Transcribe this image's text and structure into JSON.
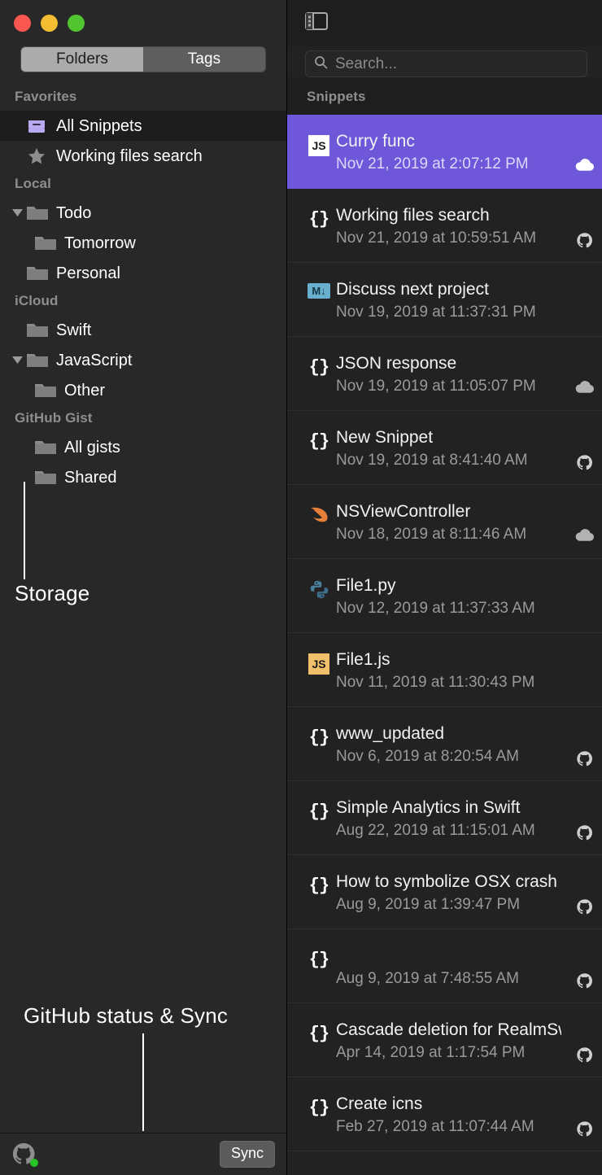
{
  "window": {
    "traffic_lights": [
      "close",
      "minimize",
      "zoom"
    ],
    "colors": {
      "close": "#f9574f",
      "minimize": "#f5bd31",
      "zoom": "#50c530",
      "selection_purple": "#6e57d8",
      "accent_icon_purple": "#b8a9f0",
      "status_green": "#23c423"
    }
  },
  "sidebar": {
    "segmented": {
      "folders_label": "Folders",
      "tags_label": "Tags",
      "selected": "Folders"
    },
    "groups": [
      {
        "label": "Favorites",
        "items": [
          {
            "label": "All Snippets",
            "icon": "inbox-tray-icon",
            "selected": true,
            "indent": 0,
            "disclosure": "none"
          },
          {
            "label": "Working files search",
            "icon": "star-icon",
            "selected": false,
            "indent": 0,
            "disclosure": "none"
          }
        ]
      },
      {
        "label": "Local",
        "items": [
          {
            "label": "Todo",
            "icon": "folder-icon",
            "selected": false,
            "indent": 0,
            "disclosure": "expanded"
          },
          {
            "label": "Tomorrow",
            "icon": "folder-icon",
            "selected": false,
            "indent": 1,
            "disclosure": "none"
          },
          {
            "label": "Personal",
            "icon": "folder-icon",
            "selected": false,
            "indent": 0,
            "disclosure": "none"
          }
        ]
      },
      {
        "label": "iCloud",
        "items": [
          {
            "label": "Swift",
            "icon": "folder-icon",
            "selected": false,
            "indent": 0,
            "disclosure": "none"
          },
          {
            "label": "JavaScript",
            "icon": "folder-icon",
            "selected": false,
            "indent": 0,
            "disclosure": "expanded"
          },
          {
            "label": "Other",
            "icon": "folder-icon",
            "selected": false,
            "indent": 1,
            "disclosure": "none"
          }
        ]
      },
      {
        "label": "GitHub Gist",
        "items": [
          {
            "label": "All gists",
            "icon": "folder-icon",
            "selected": false,
            "indent": 1,
            "disclosure": "none"
          },
          {
            "label": "Shared",
            "icon": "folder-icon",
            "selected": false,
            "indent": 1,
            "disclosure": "none"
          }
        ]
      }
    ],
    "annotations": {
      "storage": "Storage",
      "github_status_sync": "GitHub status & Sync"
    },
    "footer": {
      "github_status_icon": "github-octocat-icon",
      "github_status_indicator": "online",
      "sync_label": "Sync"
    }
  },
  "list_panel": {
    "toolbar": {
      "sidebar_toggle_icon": "sidebar-toggle-icon"
    },
    "search": {
      "icon": "search-icon",
      "placeholder": "Search...",
      "value": ""
    },
    "section_title": "Snippets",
    "snippets": [
      {
        "title": "Curry func",
        "date": "Nov 21, 2019 at 2:07:12 PM",
        "type_icon": "js-white-icon",
        "sync_badge": "icloud-cloud-icon",
        "selected": true
      },
      {
        "title": "Working files search",
        "date": "Nov 21, 2019 at 10:59:51 AM",
        "type_icon": "braces-icon",
        "sync_badge": "github-octocat-icon",
        "selected": false
      },
      {
        "title": "Discuss next project",
        "date": "Nov 19, 2019 at 11:37:31 PM",
        "type_icon": "markdown-icon",
        "sync_badge": "none",
        "selected": false
      },
      {
        "title": "JSON response",
        "date": "Nov 19, 2019 at 11:05:07 PM",
        "type_icon": "braces-icon",
        "sync_badge": "icloud-cloud-icon",
        "selected": false
      },
      {
        "title": "New Snippet",
        "date": "Nov 19, 2019 at 8:41:40 AM",
        "type_icon": "braces-icon",
        "sync_badge": "github-octocat-icon",
        "selected": false
      },
      {
        "title": "NSViewController",
        "date": "Nov 18, 2019 at 8:11:46 AM",
        "type_icon": "swift-bird-icon",
        "sync_badge": "icloud-cloud-icon",
        "selected": false
      },
      {
        "title": "File1.py",
        "date": "Nov 12, 2019 at 11:37:33 AM",
        "type_icon": "python-icon",
        "sync_badge": "none",
        "selected": false
      },
      {
        "title": "File1.js",
        "date": "Nov 11, 2019 at 11:30:43 PM",
        "type_icon": "js-amber-icon",
        "sync_badge": "none",
        "selected": false
      },
      {
        "title": "www_updated",
        "date": "Nov 6, 2019 at 8:20:54 AM",
        "type_icon": "braces-icon",
        "sync_badge": "github-octocat-icon",
        "selected": false
      },
      {
        "title": "Simple Analytics in Swift",
        "date": "Aug 22, 2019 at 11:15:01 AM",
        "type_icon": "braces-icon",
        "sync_badge": "github-octocat-icon",
        "selected": false
      },
      {
        "title": "How to symbolize OSX crash l…",
        "date": "Aug 9, 2019 at 1:39:47 PM",
        "type_icon": "braces-icon",
        "sync_badge": "github-octocat-icon",
        "selected": false
      },
      {
        "title": "",
        "date": "Aug 9, 2019 at 7:48:55 AM",
        "type_icon": "braces-icon",
        "sync_badge": "github-octocat-icon",
        "selected": false
      },
      {
        "title": "Cascade deletion for RealmSw…",
        "date": "Apr 14, 2019 at 1:17:54 PM",
        "type_icon": "braces-icon",
        "sync_badge": "github-octocat-icon",
        "selected": false
      },
      {
        "title": "Create icns",
        "date": "Feb 27, 2019 at 11:07:44 AM",
        "type_icon": "braces-icon",
        "sync_badge": "github-octocat-icon",
        "selected": false
      }
    ]
  }
}
